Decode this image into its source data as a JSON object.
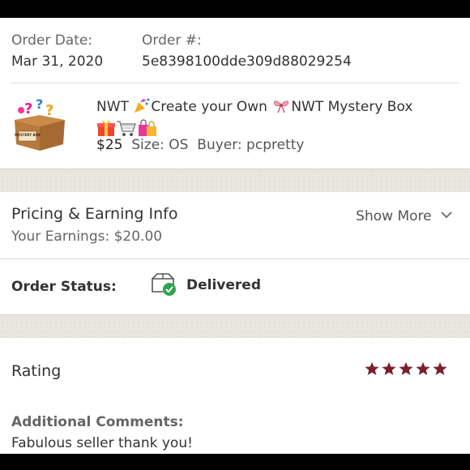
{
  "order": {
    "date_label": "Order Date:",
    "date_value": "Mar 31, 2020",
    "number_label": "Order #:",
    "number_value": "5e8398100dde309d88029254"
  },
  "item": {
    "image_icon": "mystery-box-icon",
    "image_text": "MYSTERY BOX",
    "title_part1": "NWT ",
    "title_part2": "Create your Own ",
    "title_part3": "NWT Mystery Box",
    "price": "$25",
    "size": "Size: OS",
    "buyer": "Buyer: pcpretty"
  },
  "pricing": {
    "title": "Pricing & Earning Info",
    "earnings": "Your Earnings: $20.00",
    "show_more": "Show More"
  },
  "status": {
    "label": "Order Status:",
    "value": "Delivered",
    "check_color": "#2ea44f"
  },
  "rating": {
    "title": "Rating",
    "stars": 5,
    "star_color": "#7a1f2b",
    "comments_label": "Additional Comments:",
    "comments_text": "Fabulous seller thank you!"
  }
}
